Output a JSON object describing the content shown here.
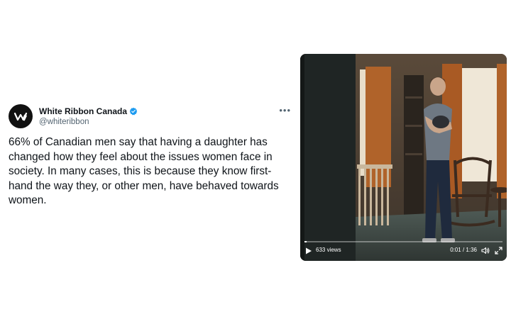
{
  "tweet": {
    "display_name": "White Ribbon Canada",
    "handle": "@whiteribbon",
    "text": "66% of Canadian men say that having a daughter has changed how they feel about the issues women face in society. In many cases, this is because they know first-hand the way they, or other men, have behaved towards women.",
    "verified": true,
    "more_icon": "more-options-icon",
    "accent_color": "#1d9bf0"
  },
  "video": {
    "views": "633 views",
    "time": "0:01 / 1:36",
    "progress": 0.01,
    "icons": [
      "play-icon",
      "volume-icon",
      "fullscreen-icon"
    ]
  }
}
